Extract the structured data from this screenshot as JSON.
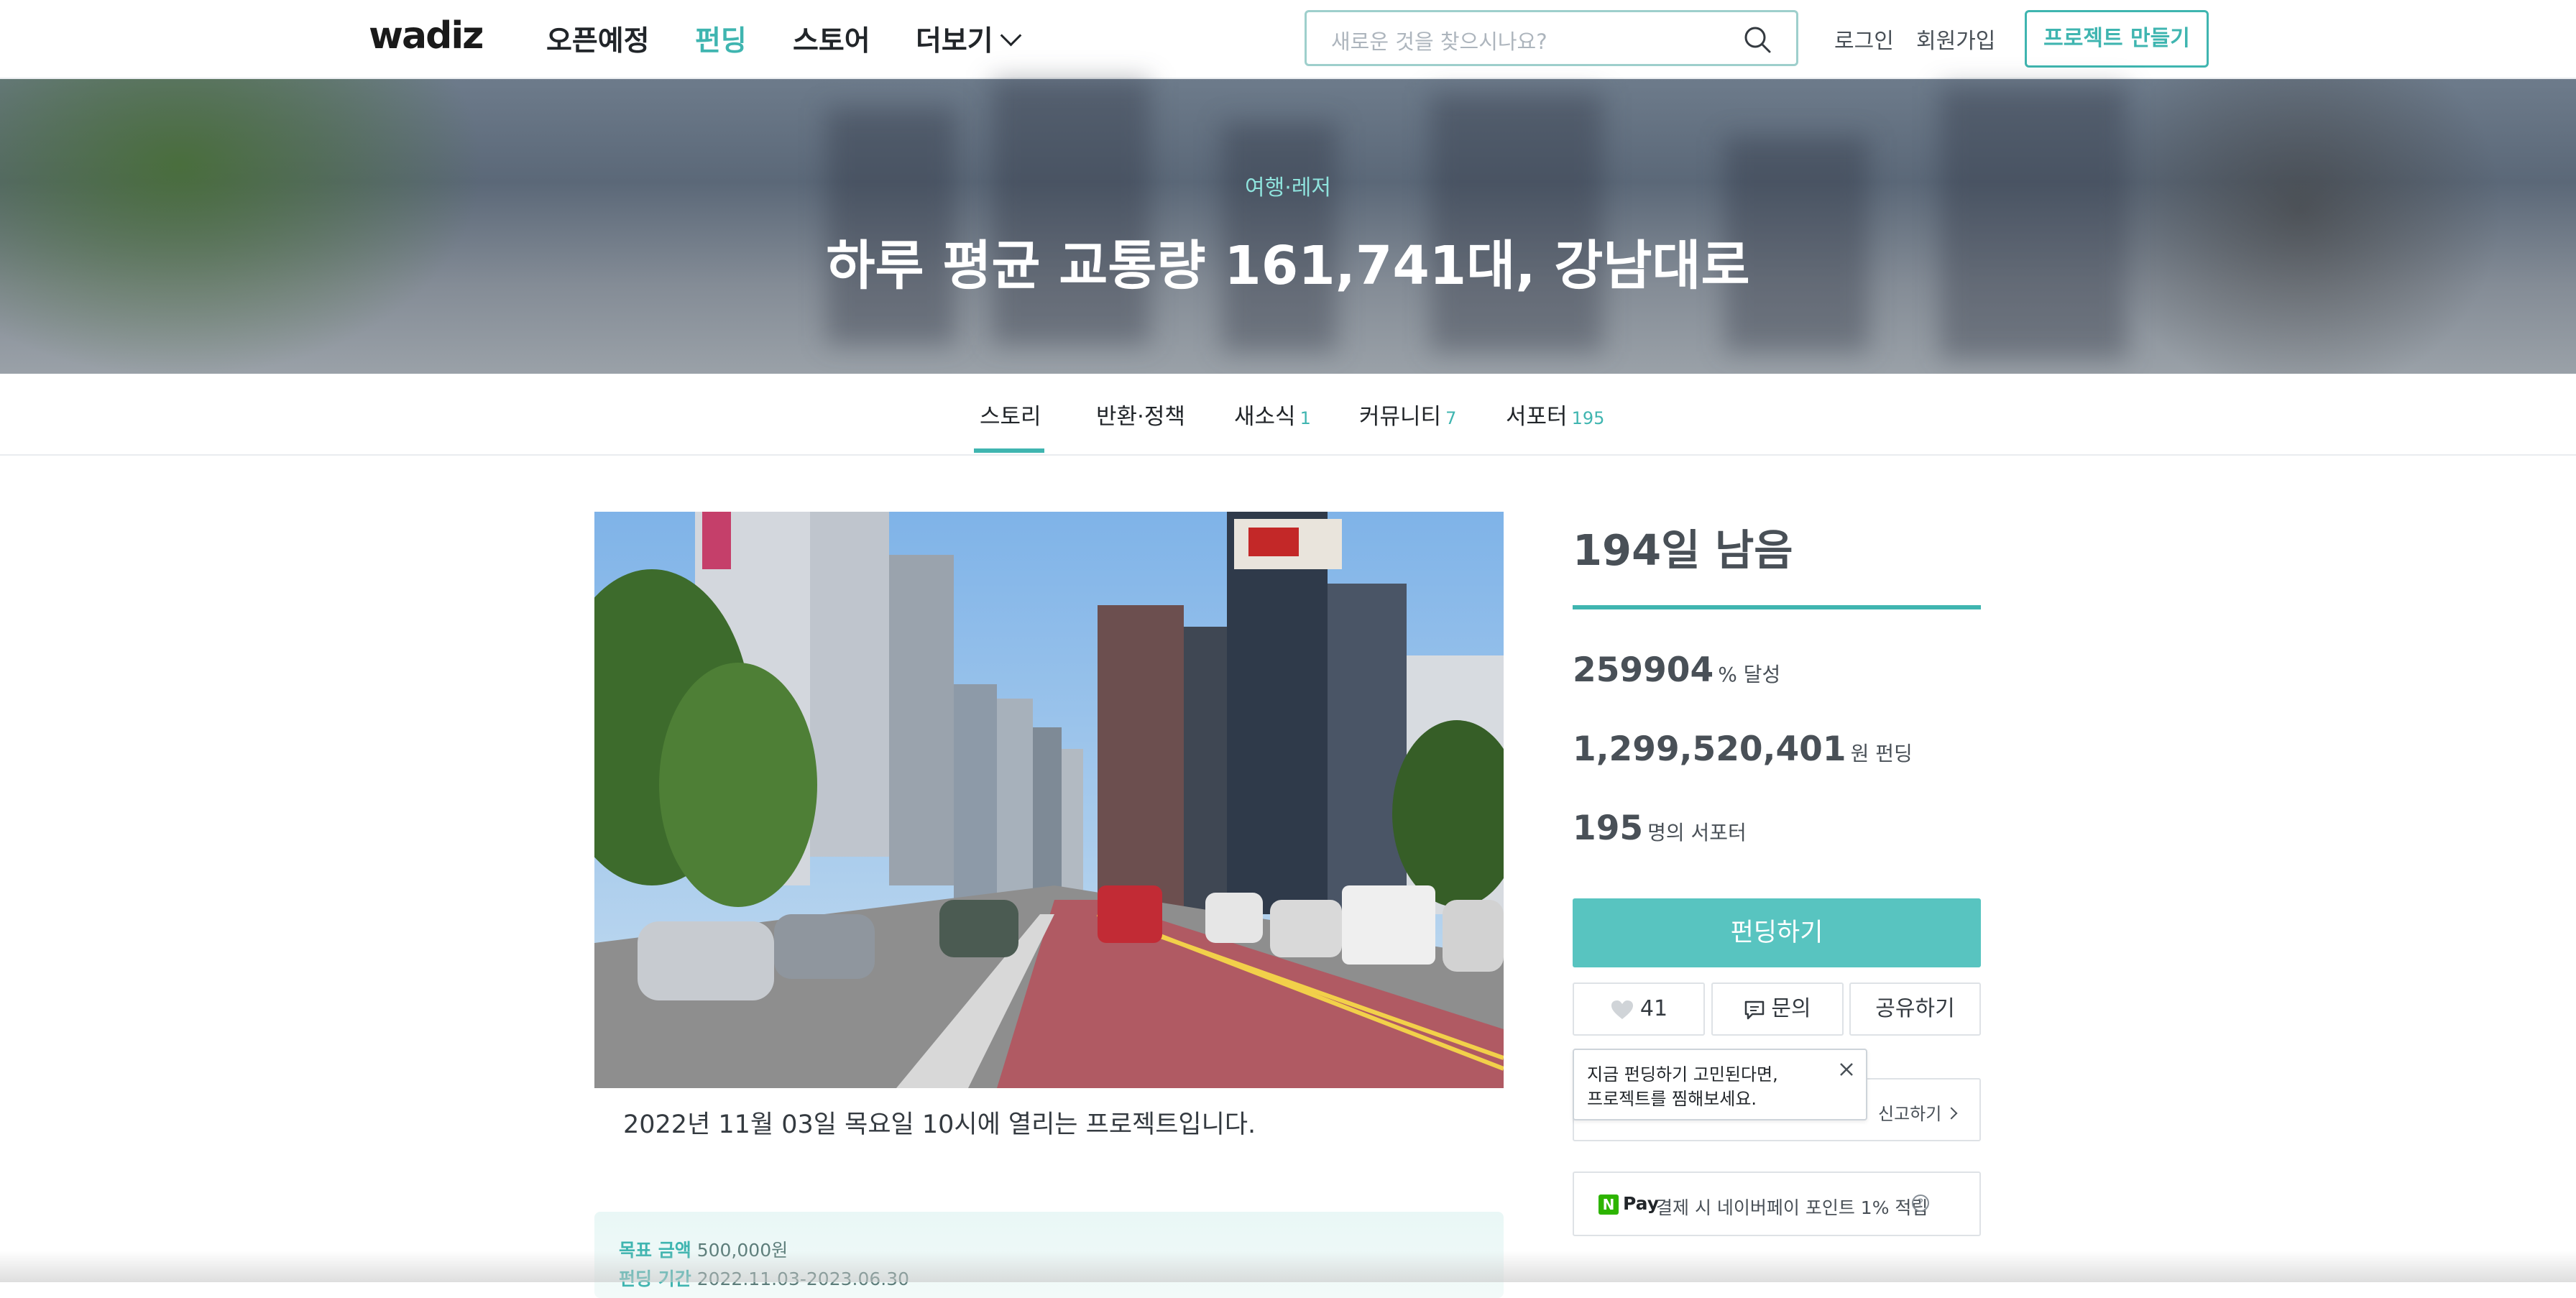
{
  "header": {
    "logo": "wadiz",
    "nav": [
      {
        "label": "오픈예정"
      },
      {
        "label": "펀딩"
      },
      {
        "label": "스토어"
      },
      {
        "label": "더보기"
      }
    ],
    "search_placeholder": "새로운 것을 찾으시나요?",
    "login": "로그인",
    "signup": "회원가입",
    "make_project": "프로젝트 만들기"
  },
  "hero": {
    "category": "여행·레저",
    "title": "하루 평균 교통량 161,741대, 강남대로"
  },
  "tabs": [
    {
      "label": "스토리",
      "count": ""
    },
    {
      "label": "반환·정책",
      "count": ""
    },
    {
      "label": "새소식",
      "count": "1"
    },
    {
      "label": "커뮤니티",
      "count": "7"
    },
    {
      "label": "서포터",
      "count": "195"
    }
  ],
  "main": {
    "notice": "2022년 11월 03일 목요일 10시에 열리는 프로젝트입니다.",
    "goal_label": "목표 금액",
    "goal_value": "500,000원",
    "period_label": "펀딩 기간",
    "period_value": "2022.11.03-2023.06.30"
  },
  "side": {
    "remaining": "194일 남음",
    "percent": "259904",
    "percent_unit": "% 달성",
    "amount": "1,299,520,401",
    "amount_unit": "원 펀딩",
    "supporters": "195",
    "supporters_unit": "명의 서포터",
    "fund_button": "펀딩하기",
    "like_count": "41",
    "inquiry": "문의",
    "share": "공유하기",
    "tooltip_line1": "지금 펀딩하기 고민된다면,",
    "tooltip_line2": "프로젝트를 찜해보세요.",
    "report": "신고하기",
    "npay_n": "N",
    "npay_pay": "Pay",
    "npay_text": "결제 시 네이버페이 포인트 1% 적립",
    "help_mark": "?"
  },
  "colors": {
    "accent": "#3fb5b0",
    "fund_button": "#58c4c0"
  }
}
